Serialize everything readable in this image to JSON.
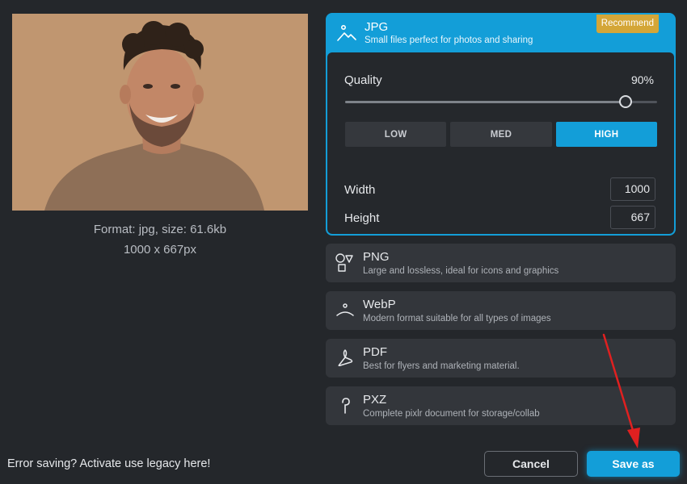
{
  "preview": {
    "file_info": "Format: jpg, size: 61.6kb",
    "dimensions": "1000 x 667px"
  },
  "jpg": {
    "icon": "image-icon",
    "title": "JPG",
    "description": "Small files perfect for photos and sharing",
    "badge": "Recommend",
    "quality_label": "Quality",
    "quality_value": "90%",
    "quality_level": 0.9,
    "presets": [
      "LOW",
      "MED",
      "HIGH"
    ],
    "active_preset": "HIGH",
    "width_label": "Width",
    "width_value": "1000",
    "height_label": "Height",
    "height_value": "667"
  },
  "formats": [
    {
      "icon": "shapes-icon",
      "title": "PNG",
      "description": "Large and lossless, ideal for icons and graphics"
    },
    {
      "icon": "webp-icon",
      "title": "WebP",
      "description": "Modern format suitable for all types of images"
    },
    {
      "icon": "pdf-icon",
      "title": "PDF",
      "description": "Best for flyers and marketing material."
    },
    {
      "icon": "pxz-icon",
      "title": "PXZ",
      "description": "Complete pixlr document for storage/collab"
    }
  ],
  "footer": {
    "legacy_text": "Error saving? Activate use legacy here!",
    "cancel_label": "Cancel",
    "save_label": "Save as"
  },
  "colors": {
    "accent": "#139ed8",
    "badge": "#d4a637",
    "background": "#24272b",
    "annotation_arrow": "#e02020"
  }
}
